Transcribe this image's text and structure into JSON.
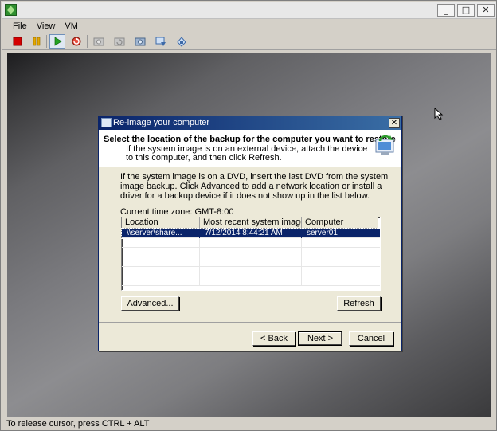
{
  "menu": {
    "items": [
      "File",
      "View",
      "VM"
    ]
  },
  "titlebar": {
    "minimize": "_",
    "maximize": "□",
    "close": "✕"
  },
  "dialog": {
    "title": "Re-image your computer",
    "close": "✕",
    "heading": "Select the location of the backup for the computer you want to restore",
    "subtext": "If the system image is on an external device, attach the device to this computer, and then click Refresh.",
    "description": "If the system image is on a DVD, insert the last DVD from the system image backup. Click Advanced to add a network location or install a driver for a backup device if it does not show up in the list below.",
    "timezone": "Current time zone: GMT-8:00",
    "columns": [
      "Location",
      "Most recent system image",
      "Computer"
    ],
    "rows": [
      {
        "location": "\\\\server\\share...",
        "image": "7/12/2014 8:44:21 AM",
        "computer": "server01",
        "selected": true
      }
    ],
    "buttons": {
      "advanced": "Advanced...",
      "refresh": "Refresh",
      "back": "< Back",
      "next": "Next >",
      "cancel": "Cancel"
    }
  },
  "status": "To release cursor, press CTRL + ALT",
  "colors": {
    "accent": "#0a246a",
    "stop": "#d40000",
    "pause": "#e5a800",
    "play": "#23a323"
  }
}
